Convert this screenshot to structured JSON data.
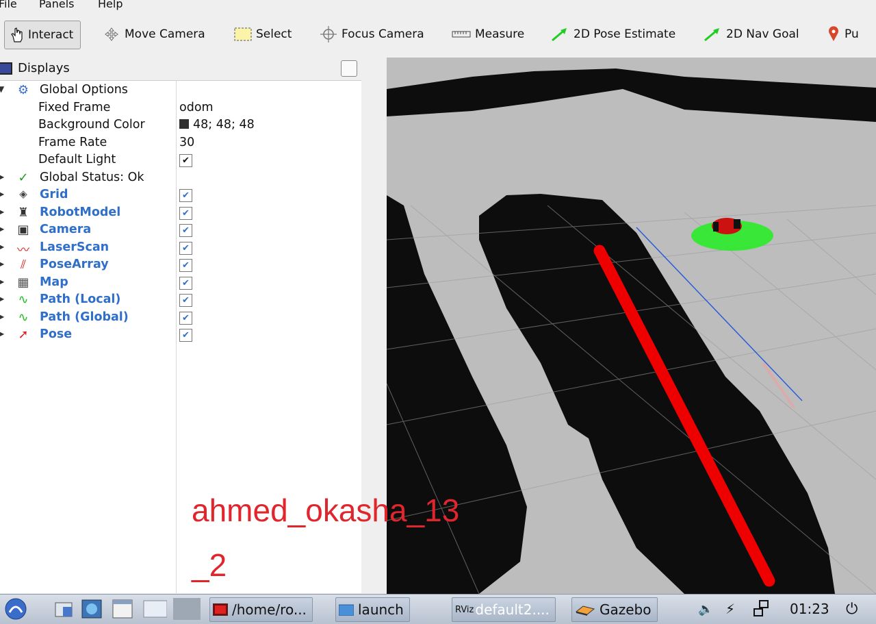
{
  "menu": [
    "File",
    "Panels",
    "Help"
  ],
  "toolbar": {
    "tools": [
      "Interact",
      "Move Camera",
      "Select",
      "Focus Camera",
      "Measure",
      "2D Pose Estimate",
      "2D Nav Goal",
      "Pu"
    ]
  },
  "displays": {
    "title": "Displays",
    "global_options": {
      "label": "Global Options",
      "fixed_frame_label": "Fixed Frame",
      "fixed_frame_value": "odom",
      "background_color_label": "Background Color",
      "background_color_value": "48; 48; 48",
      "frame_rate_label": "Frame Rate",
      "frame_rate_value": "30",
      "default_light_label": "Default Light"
    },
    "global_status": "Global Status: Ok",
    "items": [
      "Grid",
      "RobotModel",
      "Camera",
      "LaserScan",
      "PoseArray",
      "Map",
      "Path (Local)",
      "Path (Global)",
      "Pose"
    ]
  },
  "watermark": {
    "line1": "ahmed_okasha_13",
    "line2": "_2"
  },
  "taskbar": {
    "tasks": [
      "/home/ro...",
      "launch",
      "default2....",
      "Gazebo"
    ],
    "clock": "01:23"
  },
  "colors": {
    "accent_blue": "#2f6fc9",
    "path_red": "#ff0000",
    "particles_green": "#22ee22",
    "watermark_red": "#e0262d"
  }
}
